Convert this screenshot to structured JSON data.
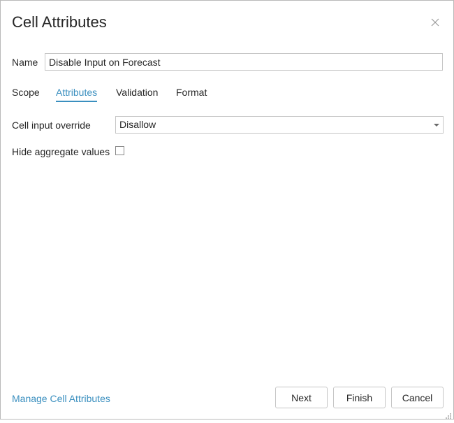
{
  "dialog": {
    "title": "Cell Attributes",
    "close_icon": "close-icon"
  },
  "name_field": {
    "label": "Name",
    "value": "Disable Input on Forecast"
  },
  "tabs": [
    {
      "label": "Scope",
      "active": false
    },
    {
      "label": "Attributes",
      "active": true
    },
    {
      "label": "Validation",
      "active": false
    },
    {
      "label": "Format",
      "active": false
    }
  ],
  "attributes": {
    "cell_input_override": {
      "label": "Cell input override",
      "selected": "Disallow"
    },
    "hide_aggregate": {
      "label": "Hide aggregate values",
      "checked": false
    }
  },
  "footer": {
    "manage_link": "Manage Cell Attributes",
    "next_label": "Next",
    "finish_label": "Finish",
    "cancel_label": "Cancel"
  },
  "colors": {
    "accent": "#3a8fbf",
    "border": "#c6c6c6",
    "text": "#262626"
  }
}
